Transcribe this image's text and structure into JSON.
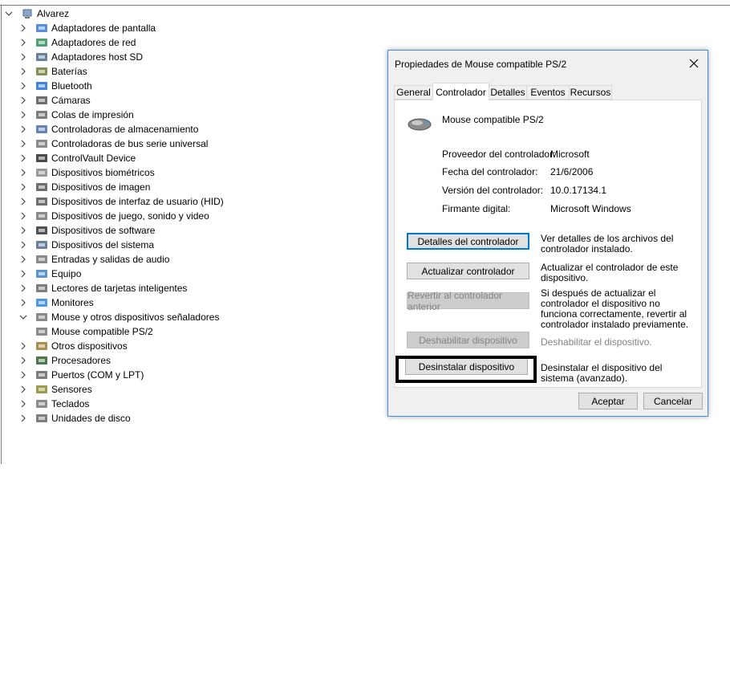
{
  "tree": {
    "root_label": "Alvarez",
    "categories": [
      {
        "label": "Adaptadores de pantalla",
        "icon": "display-adapter-icon"
      },
      {
        "label": "Adaptadores de red",
        "icon": "network-adapter-icon"
      },
      {
        "label": "Adaptadores host SD",
        "icon": "sd-host-icon"
      },
      {
        "label": "Baterías",
        "icon": "battery-icon"
      },
      {
        "label": "Bluetooth",
        "icon": "bluetooth-icon"
      },
      {
        "label": "Cámaras",
        "icon": "camera-icon"
      },
      {
        "label": "Colas de impresión",
        "icon": "printer-icon"
      },
      {
        "label": "Controladoras de almacenamiento",
        "icon": "storage-controller-icon"
      },
      {
        "label": "Controladoras de bus serie universal",
        "icon": "usb-icon"
      },
      {
        "label": "ControlVault Device",
        "icon": "controlvault-icon"
      },
      {
        "label": "Dispositivos biométricos",
        "icon": "fingerprint-icon"
      },
      {
        "label": "Dispositivos de imagen",
        "icon": "scanner-icon"
      },
      {
        "label": "Dispositivos de interfaz de usuario (HID)",
        "icon": "hid-icon"
      },
      {
        "label": "Dispositivos de juego, sonido y video",
        "icon": "speaker-icon"
      },
      {
        "label": "Dispositivos de software",
        "icon": "software-device-icon"
      },
      {
        "label": "Dispositivos del sistema",
        "icon": "system-device-icon"
      },
      {
        "label": "Entradas y salidas de audio",
        "icon": "audio-io-icon"
      },
      {
        "label": "Equipo",
        "icon": "computer-icon"
      },
      {
        "label": "Lectores de tarjetas inteligentes",
        "icon": "smart-card-icon"
      },
      {
        "label": "Monitores",
        "icon": "monitor-icon"
      },
      {
        "label": "Mouse y otros dispositivos señaladores",
        "icon": "mouse-icon"
      },
      {
        "label": "Mouse compatible PS/2",
        "icon": "mouse-icon"
      },
      {
        "label": "Otros dispositivos",
        "icon": "unknown-device-icon"
      },
      {
        "label": "Procesadores",
        "icon": "processor-icon"
      },
      {
        "label": "Puertos (COM y LPT)",
        "icon": "port-icon"
      },
      {
        "label": "Sensores",
        "icon": "sensor-icon"
      },
      {
        "label": "Teclados",
        "icon": "keyboard-icon"
      },
      {
        "label": "Unidades de disco",
        "icon": "disk-drive-icon"
      }
    ]
  },
  "dialog": {
    "title": "Propiedades de Mouse compatible PS/2",
    "tabs": [
      "General",
      "Controlador",
      "Detalles",
      "Eventos",
      "Recursos"
    ],
    "active_tab": "Controlador",
    "device_name": "Mouse compatible PS/2",
    "properties": [
      {
        "label": "Proveedor del controlador:",
        "value": "Microsoft"
      },
      {
        "label": "Fecha del controlador:",
        "value": "21/6/2006"
      },
      {
        "label": "Versión del controlador:",
        "value": "10.0.17134.1"
      },
      {
        "label": "Firmante digital:",
        "value": "Microsoft Windows"
      }
    ],
    "actions": [
      {
        "label": "Detalles del controlador",
        "description": "Ver detalles de los archivos del controlador instalado.",
        "enabled": true
      },
      {
        "label": "Actualizar controlador",
        "description": "Actualizar el controlador de este dispositivo.",
        "enabled": true
      },
      {
        "label": "Revertir al controlador anterior",
        "description": "Si después de actualizar el controlador el dispositivo no funciona correctamente, revertir al controlador instalado previamente.",
        "enabled": false
      },
      {
        "label": "Deshabilitar dispositivo",
        "description": "Deshabilitar el dispositivo.",
        "enabled": false
      },
      {
        "label": "Desinstalar dispositivo",
        "description": "Desinstalar el dispositivo del sistema (avanzado).",
        "enabled": true
      }
    ],
    "ok_label": "Aceptar",
    "cancel_label": "Cancelar"
  },
  "colors": {
    "accent": "#0078d7",
    "dialog_bg": "#f0f0f0",
    "highlight": "#000000"
  }
}
